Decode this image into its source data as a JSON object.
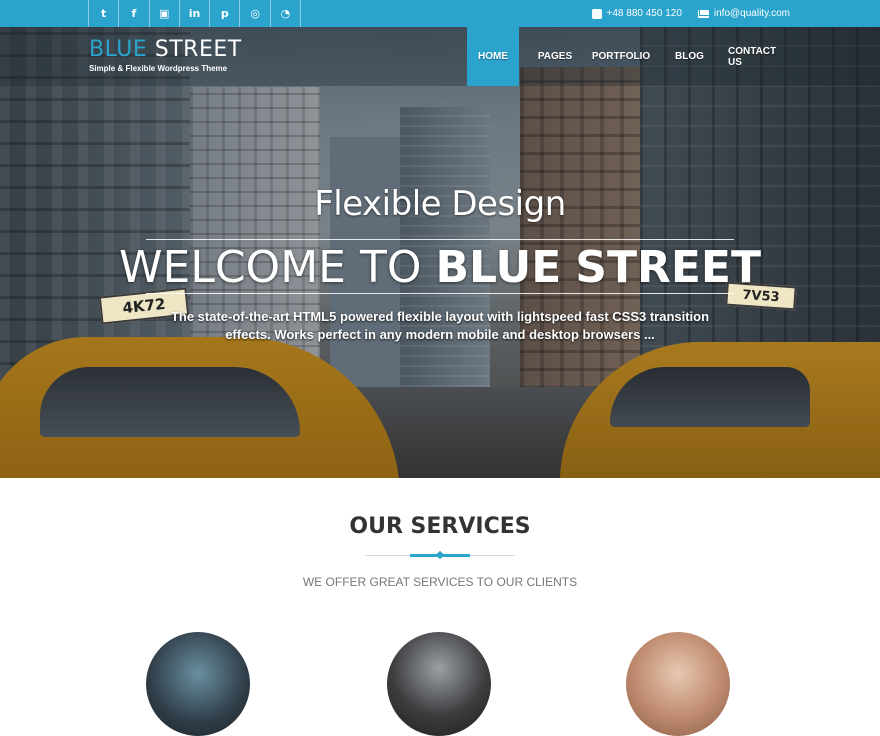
{
  "topbar": {
    "social": [
      {
        "icon": "twitter-icon",
        "glyph": "t"
      },
      {
        "icon": "facebook-icon",
        "glyph": "f"
      },
      {
        "icon": "youtube-icon",
        "glyph": "▣"
      },
      {
        "icon": "linkedin-icon",
        "glyph": "in"
      },
      {
        "icon": "pinterest-icon",
        "glyph": "p"
      },
      {
        "icon": "dribbble-icon",
        "glyph": "◎"
      },
      {
        "icon": "rss-icon",
        "glyph": "◔"
      }
    ],
    "phone": "+48 880 450 120",
    "email": "info@quality.com"
  },
  "header": {
    "logo_part1": "BLUE",
    "logo_part2": "STREET",
    "tagline": "Simple & Flexible Wordpress Theme",
    "nav": [
      "HOME",
      "PAGES",
      "PORTFOLIO",
      "BLOG",
      "CONTACT US"
    ],
    "active_nav": "HOME"
  },
  "hero": {
    "subtitle": "Flexible Design",
    "title_thin": "WELCOME TO",
    "title_bold1": "BLUE",
    "title_bold2": "STREET",
    "description": "The state-of-the-art HTML5 powered flexible layout with lightspeed fast CSS3 transition effects. Works perfect in any modern mobile and desktop browsers ...",
    "taxi_sign_left": "4K72",
    "taxi_sign_right": "7V53"
  },
  "services": {
    "title": "OUR SERVICES",
    "subtitle": "WE OFFER GREAT SERVICES TO OUR CLIENTS"
  },
  "colors": {
    "accent": "#2aa3cd",
    "text_dark": "#333333",
    "text_muted": "#777777"
  }
}
